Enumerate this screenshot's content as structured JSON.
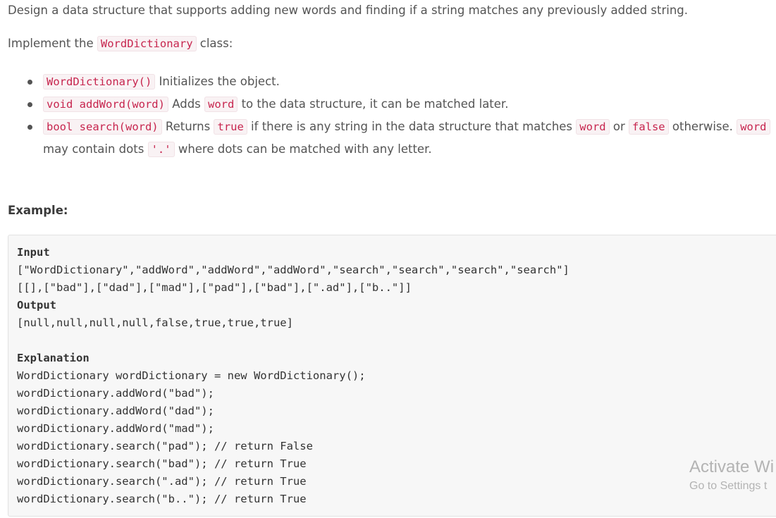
{
  "description": {
    "intro": "Design a data structure that supports adding new words and finding if a string matches any previously added string.",
    "implement_prefix": "Implement the ",
    "implement_class": "WordDictionary",
    "implement_suffix": " class:",
    "bullets": [
      {
        "code": "WordDictionary()",
        "text": " Initializes the object."
      },
      {
        "code": "void addWord(word)",
        "text1": " Adds ",
        "code2": "word",
        "text2": " to the data structure, it can be matched later."
      },
      {
        "code": "bool search(word)",
        "text1": " Returns ",
        "code2": "true",
        "text2": " if there is any string in the data structure that matches ",
        "code3": "word",
        "text3": " or ",
        "code4": "false",
        "text4": " otherwise. ",
        "code5": "word",
        "text5": " may contain dots ",
        "code6": "'.'",
        "text6": " where dots can be matched with any letter."
      }
    ]
  },
  "example": {
    "heading": "Example:",
    "lines": [
      {
        "text": "Input",
        "bold": true
      },
      {
        "text": "[\"WordDictionary\",\"addWord\",\"addWord\",\"addWord\",\"search\",\"search\",\"search\",\"search\"]",
        "bold": false
      },
      {
        "text": "[[],[\"bad\"],[\"dad\"],[\"mad\"],[\"pad\"],[\"bad\"],[\".ad\"],[\"b..\"]]",
        "bold": false
      },
      {
        "text": "Output",
        "bold": true
      },
      {
        "text": "[null,null,null,null,false,true,true,true]",
        "bold": false
      },
      {
        "text": "",
        "bold": false
      },
      {
        "text": "Explanation",
        "bold": true
      },
      {
        "text": "WordDictionary wordDictionary = new WordDictionary();",
        "bold": false
      },
      {
        "text": "wordDictionary.addWord(\"bad\");",
        "bold": false
      },
      {
        "text": "wordDictionary.addWord(\"dad\");",
        "bold": false
      },
      {
        "text": "wordDictionary.addWord(\"mad\");",
        "bold": false
      },
      {
        "text": "wordDictionary.search(\"pad\"); // return False",
        "bold": false
      },
      {
        "text": "wordDictionary.search(\"bad\"); // return True",
        "bold": false
      },
      {
        "text": "wordDictionary.search(\".ad\"); // return True",
        "bold": false
      },
      {
        "text": "wordDictionary.search(\"b..\"); // return True",
        "bold": false
      }
    ]
  },
  "watermark": {
    "title": "Activate Wi",
    "subtitle": "Go to Settings t"
  }
}
